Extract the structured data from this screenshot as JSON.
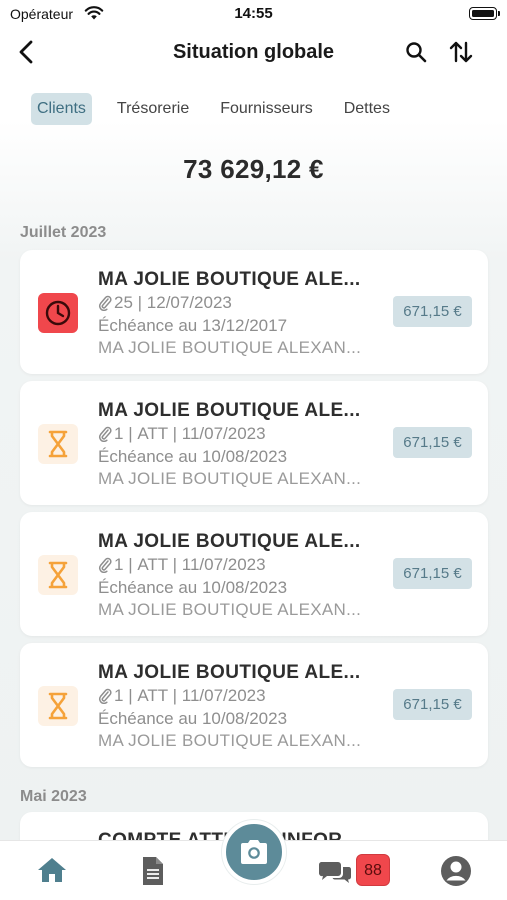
{
  "status_bar": {
    "carrier": "Opérateur",
    "time": "14:55"
  },
  "nav": {
    "title": "Situation globale"
  },
  "tabs": [
    {
      "label": "Clients",
      "active": true
    },
    {
      "label": "Trésorerie",
      "active": false
    },
    {
      "label": "Fournisseurs",
      "active": false
    },
    {
      "label": "Dettes",
      "active": false
    }
  ],
  "total": "73 629,12 €",
  "sections": [
    {
      "title": "Juillet 2023",
      "items": [
        {
          "status": "late",
          "icon": "clock-icon",
          "name": "MA JOLIE BOUTIQUE ALE...",
          "attachments": "25",
          "meta": "12/07/2023",
          "due": "Échéance au 13/12/2017",
          "desc": "MA JOLIE BOUTIQUE ALEXAN...",
          "amount": "671,15 €"
        },
        {
          "status": "waiting",
          "icon": "hourglass-icon",
          "name": "MA JOLIE BOUTIQUE ALE...",
          "attachments": "1",
          "meta": "ATT | 11/07/2023",
          "due": "Échéance au 10/08/2023",
          "desc": "MA JOLIE BOUTIQUE ALEXAN...",
          "amount": "671,15 €"
        },
        {
          "status": "waiting",
          "icon": "hourglass-icon",
          "name": "MA JOLIE BOUTIQUE ALE...",
          "attachments": "1",
          "meta": "ATT | 11/07/2023",
          "due": "Échéance au 10/08/2023",
          "desc": "MA JOLIE BOUTIQUE ALEXAN...",
          "amount": "671,15 €"
        },
        {
          "status": "waiting",
          "icon": "hourglass-icon",
          "name": "MA JOLIE BOUTIQUE ALE...",
          "attachments": "1",
          "meta": "ATT | 11/07/2023",
          "due": "Échéance au 10/08/2023",
          "desc": "MA JOLIE BOUTIQUE ALEXAN...",
          "amount": "671,15 €"
        }
      ]
    },
    {
      "title": "Mai 2023",
      "items": [
        {
          "name": "COMPTE ATTENTE INFOR"
        }
      ]
    }
  ],
  "tabbar": {
    "items": [
      "home-icon",
      "document-icon",
      "camera-icon",
      "chat-icon",
      "profile-icon"
    ],
    "chat_badge": "88"
  },
  "colors": {
    "accent": "#5d8b99",
    "tab_active_bg": "#d2e1e6",
    "late": "#f0474c",
    "waiting": "#f5a23a"
  }
}
